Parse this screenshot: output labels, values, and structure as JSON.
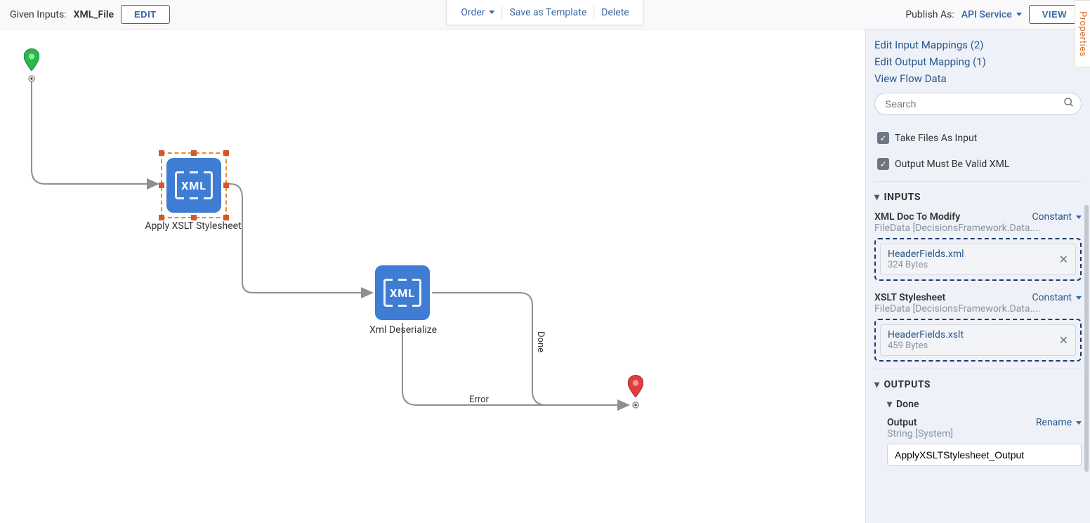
{
  "topbar": {
    "given_label": "Given Inputs:",
    "given_value": "XML_File",
    "edit": "EDIT",
    "order": "Order",
    "save_template": "Save as Template",
    "delete": "Delete",
    "publish_label": "Publish As:",
    "publish_value": "API Service",
    "view": "VIEW"
  },
  "canvas": {
    "node_xslt": "Apply XSLT Stylesheet",
    "node_deser": "Xml Deserialize",
    "xml_glyph": "XML",
    "edge_done": "Done",
    "edge_error": "Error"
  },
  "panel": {
    "links": {
      "in_map": "Edit Input Mappings (2)",
      "out_map": "Edit Output Mapping (1)",
      "flow_data": "View Flow Data"
    },
    "search_placeholder": "Search",
    "take_files": "Take Files As Input",
    "valid_xml": "Output Must Be Valid XML",
    "inputs_title": "INPUTS",
    "xml_doc": {
      "label": "XML Doc To Modify",
      "mode": "Constant",
      "type": "FileData [DecisionsFramework.Data....",
      "file_name": "HeaderFields.xml",
      "file_size": "324 Bytes"
    },
    "xslt": {
      "label": "XSLT Stylesheet",
      "mode": "Constant",
      "type": "FileData [DecisionsFramework.Data....",
      "file_name": "HeaderFields.xslt",
      "file_size": "459 Bytes"
    },
    "outputs_title": "OUTPUTS",
    "done_title": "Done",
    "output_label": "Output",
    "rename": "Rename",
    "output_type": "String [System]",
    "output_value": "ApplyXSLTStylesheet_Output",
    "side_tab": "Properties"
  }
}
